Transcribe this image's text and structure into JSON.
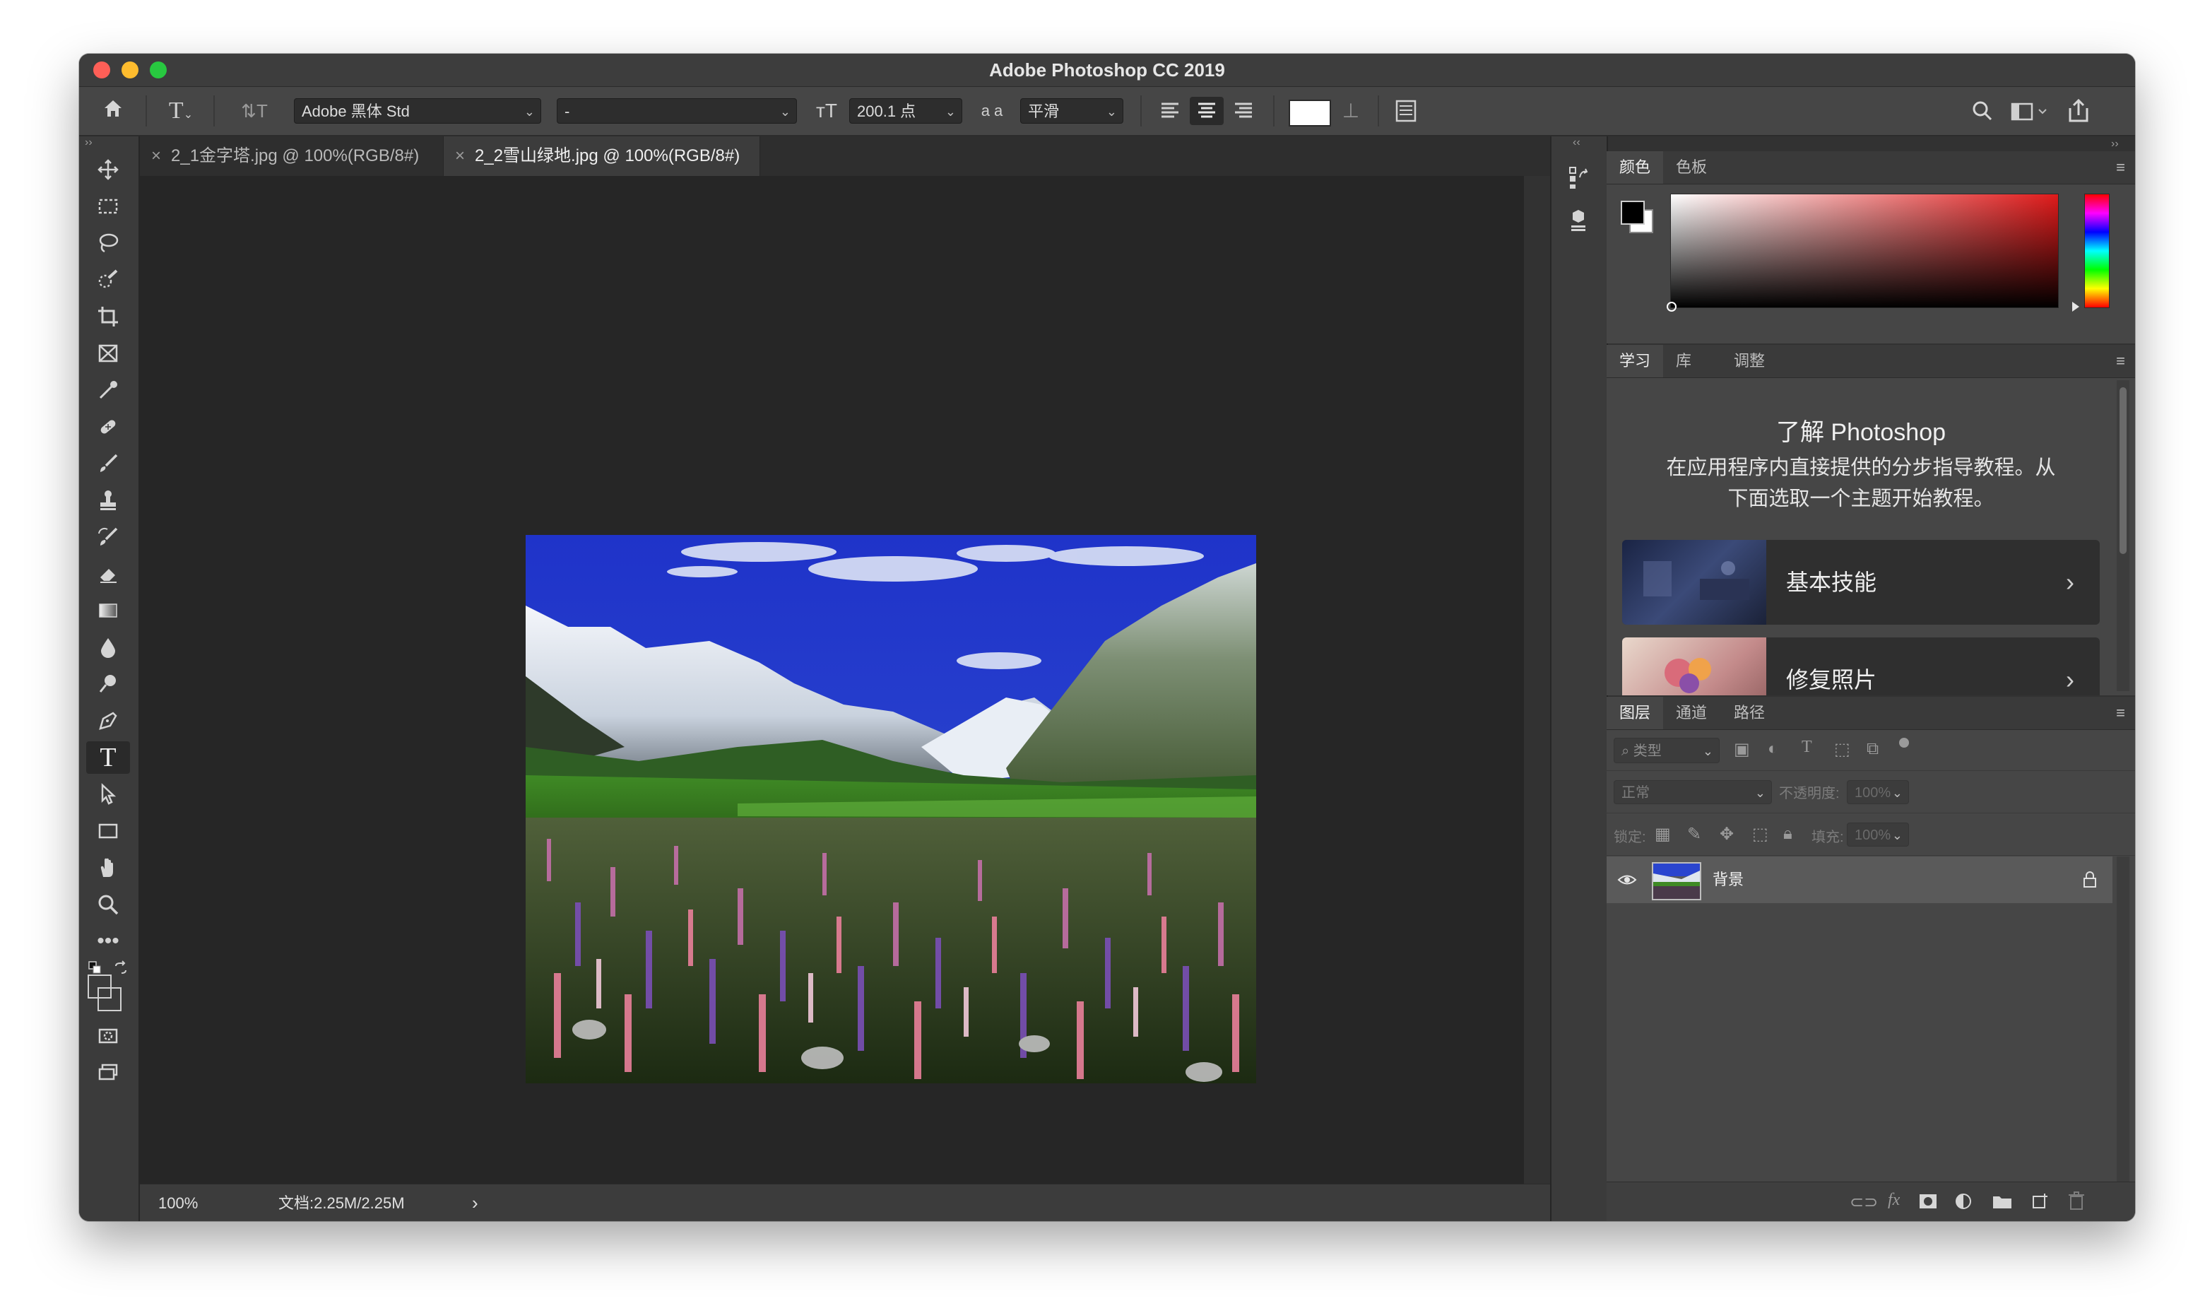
{
  "window": {
    "title": "Adobe Photoshop CC 2019"
  },
  "options_bar": {
    "font_family": "Adobe 黑体 Std",
    "font_style": "-",
    "font_size": "200.1 点",
    "aa_icon_label": "a a",
    "antialias": "平滑",
    "icons": {
      "home": "home-icon",
      "type": "type-tool-icon",
      "orientation": "text-orientation-icon",
      "size": "font-size-icon",
      "align_left": "align-left-icon",
      "align_center": "align-center-icon",
      "align_right": "align-right-icon",
      "warp": "warp-text-icon",
      "panels": "character-panel-icon",
      "search": "search-icon",
      "workspace": "workspace-icon",
      "share": "share-icon"
    },
    "text_color": "#ffffff"
  },
  "tabs": [
    {
      "close": "×",
      "label": "2_1金字塔.jpg @ 100%(RGB/8#)",
      "active": false
    },
    {
      "close": "×",
      "label": "2_2雪山绿地.jpg @ 100%(RGB/8#)",
      "active": true
    }
  ],
  "collapse": {
    "left": "››",
    "dock": "‹‹",
    "right": "››"
  },
  "toolbar": {
    "tools": [
      "move-tool",
      "marquee-tool",
      "lasso-tool",
      "quick-select-tool",
      "crop-tool",
      "frame-tool",
      "eyedropper-tool",
      "healing-brush-tool",
      "brush-tool",
      "clone-stamp-tool",
      "history-brush-tool",
      "eraser-tool",
      "gradient-tool",
      "blur-tool",
      "dodge-tool",
      "pen-tool",
      "type-tool",
      "path-select-tool",
      "rectangle-tool",
      "hand-tool",
      "zoom-tool",
      "edit-toolbar"
    ],
    "selected_tool": "type-tool",
    "foreground_color": "#000000",
    "background_color": "#ffffff"
  },
  "status": {
    "zoom": "100%",
    "doc": "文档:2.25M/2.25M",
    "arrow": "›"
  },
  "color_panel": {
    "tabs": [
      "颜色",
      "色板"
    ],
    "active_tab": 0,
    "hue_color": "#e01b1b",
    "menu": "≡"
  },
  "learn_panel": {
    "tabs": [
      "学习",
      "库",
      "调整"
    ],
    "active_tab": 0,
    "menu": "≡",
    "heading": "了解 Photoshop",
    "desc_line1": "在应用程序内直接提供的分步指导教程。从",
    "desc_line2": "下面选取一个主题开始教程。",
    "cards": [
      {
        "label": "基本技能",
        "chevron": "›"
      },
      {
        "label": "修复照片",
        "chevron": "›"
      }
    ]
  },
  "layers_panel": {
    "tabs": [
      "图层",
      "通道",
      "路径"
    ],
    "active_tab": 0,
    "menu": "≡",
    "filter_placeholder": "类型",
    "filter_icon": "search-icon",
    "blend_mode": "正常",
    "opacity_label": "不透明度:",
    "opacity_value": "100%",
    "lock_label": "锁定:",
    "fill_label": "填充:",
    "fill_value": "100%",
    "layers": [
      {
        "name": "背景",
        "visible": true,
        "locked": true
      }
    ],
    "footer_icons": [
      "link-icon",
      "fx-icon",
      "mask-icon",
      "adjustment-icon",
      "group-icon",
      "new-layer-icon",
      "trash-icon"
    ],
    "fx_label": "fx"
  }
}
